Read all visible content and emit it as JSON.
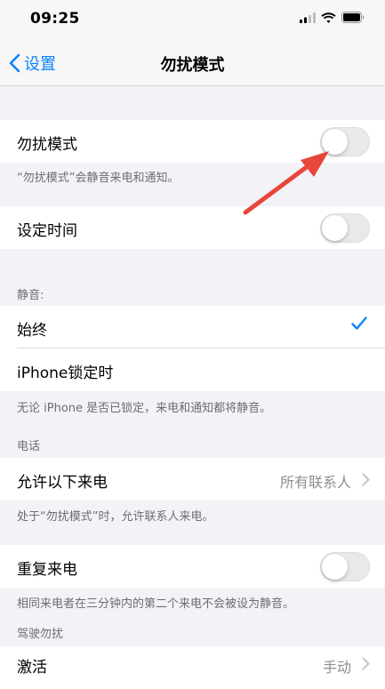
{
  "status": {
    "time": "09:25"
  },
  "nav": {
    "back_label": "设置",
    "title": "勿扰模式"
  },
  "dnd": {
    "label": "勿扰模式",
    "toggle_on": false,
    "note": "“勿扰模式”会静音来电和通知。"
  },
  "schedule": {
    "label": "设定时间",
    "toggle_on": false
  },
  "silence": {
    "header": "静音:",
    "options": [
      {
        "label": "始终",
        "selected": true
      },
      {
        "label": "iPhone锁定时",
        "selected": false
      }
    ],
    "note": "无论 iPhone 是否已锁定，来电和通知都将静音。"
  },
  "phone": {
    "header": "电话",
    "allow_calls": {
      "label": "允许以下来电",
      "value": "所有联系人"
    },
    "note": "处于“勿扰模式”时，允许联系人来电。",
    "repeated_calls": {
      "label": "重复来电",
      "toggle_on": false
    },
    "repeated_note": "相同来电者在三分钟内的第二个来电不会被设为静音。"
  },
  "driving": {
    "header": "驾驶勿扰",
    "activate": {
      "label": "激活",
      "value": "手动"
    }
  },
  "colors": {
    "accent": "#0a84ff",
    "annotation_arrow": "#e8463a"
  }
}
